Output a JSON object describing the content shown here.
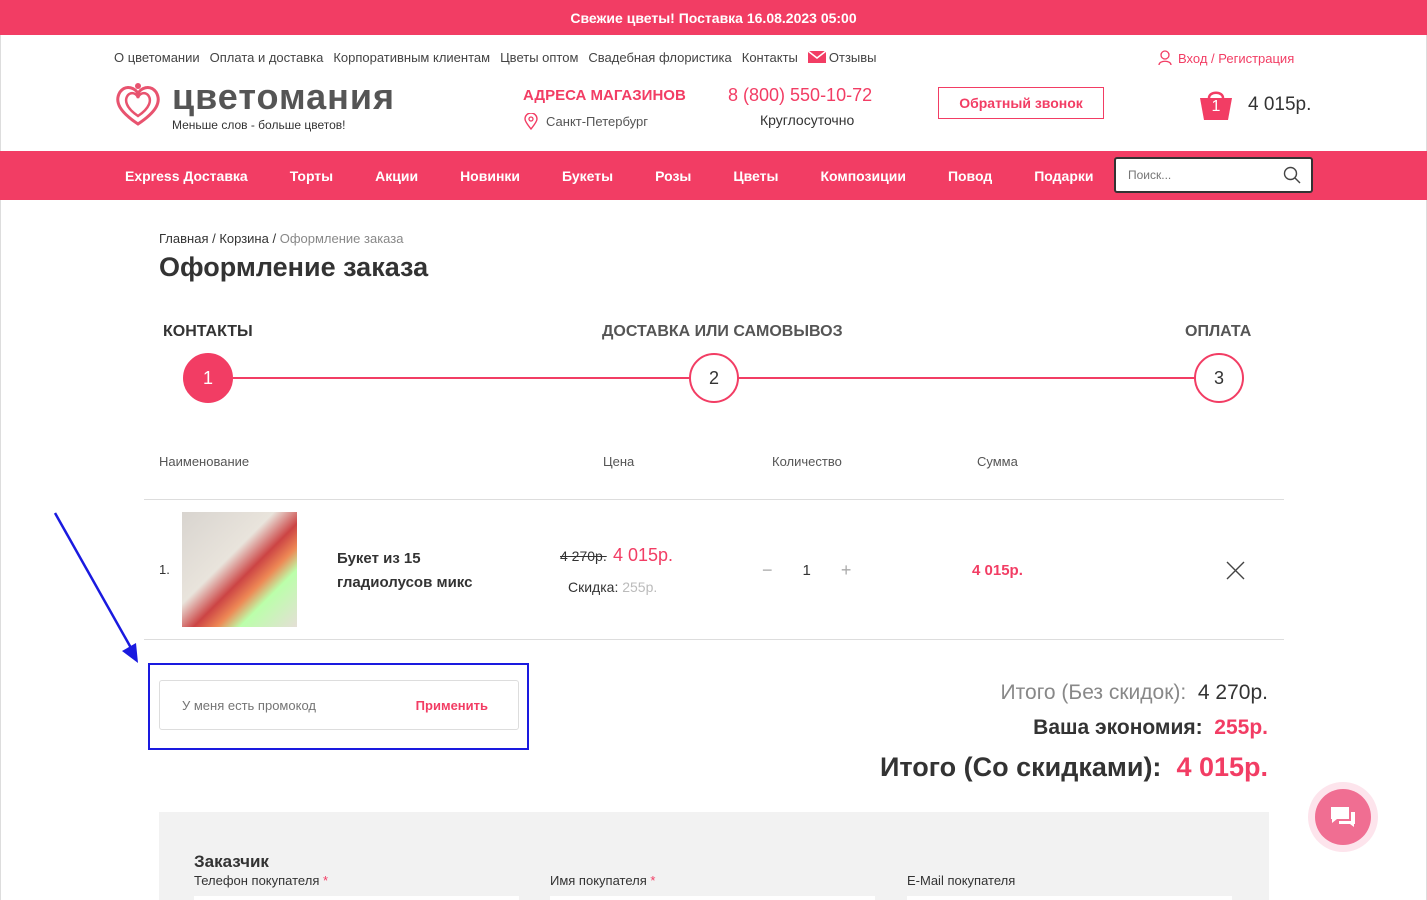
{
  "promo_bar": {
    "text": "Свежие цветы! Поставка 16.08.2023 05:00"
  },
  "header": {
    "top_links": [
      "О цветомании",
      "Оплата и доставка",
      "Корпоративным клиентам",
      "Цветы оптом",
      "Свадебная флористика",
      "Контакты"
    ],
    "reviews_label": "Отзывы",
    "login_label": "Вход / Регистрация",
    "logo_name": "цветомания",
    "logo_slogan": "Меньше слов - больше цветов!",
    "stores_label": "АДРЕСА МАГАЗИНОВ",
    "city": "Санкт-Петербург",
    "phone": "8 (800) 550-10-72",
    "hours": "Круглосуточно",
    "callback_label": "Обратный звонок",
    "cart_count": "1",
    "cart_total": "4 015р."
  },
  "nav": {
    "items": [
      "Express Доставка",
      "Торты",
      "Акции",
      "Новинки",
      "Букеты",
      "Розы",
      "Цветы",
      "Композиции",
      "Повод",
      "Подарки"
    ],
    "search_placeholder": "Поиск..."
  },
  "breadcrumb": {
    "home": "Главная",
    "cart": "Корзина",
    "current": "Оформление заказа"
  },
  "page_title": "Оформление заказа",
  "steps": [
    {
      "label": "КОНТАКТЫ",
      "number": "1",
      "active": true
    },
    {
      "label": "ДОСТАВКА ИЛИ САМОВЫВОЗ",
      "number": "2",
      "active": false
    },
    {
      "label": "ОПЛАТА",
      "number": "3",
      "active": false
    }
  ],
  "table": {
    "headers": {
      "name": "Наименование",
      "price": "Цена",
      "qty": "Количество",
      "sum": "Сумма"
    },
    "rows": [
      {
        "index": "1.",
        "name": "Букет из 15 гладиолусов микс",
        "old_price": "4 270р.",
        "price": "4 015р.",
        "discount_label": "Скидка:",
        "discount_value": "255р.",
        "minus": "−",
        "qty": "1",
        "plus": "+",
        "sum": "4 015р."
      }
    ]
  },
  "promo": {
    "placeholder": "У меня есть промокод",
    "apply_label": "Применить"
  },
  "totals": {
    "no_discount_label": "Итого (Без скидок):",
    "no_discount_value": "4 270р.",
    "savings_label": "Ваша экономия:",
    "savings_value": "255р.",
    "with_discount_label": "Итого (Со скидками):",
    "with_discount_value": "4 015р."
  },
  "customer": {
    "title": "Заказчик",
    "phone_label": "Телефон покупателя",
    "name_label": "Имя покупателя",
    "email_label": "E-Mail покупателя",
    "required_mark": "*"
  },
  "colors": {
    "accent": "#f23d64",
    "highlight": "#1a1adf"
  }
}
